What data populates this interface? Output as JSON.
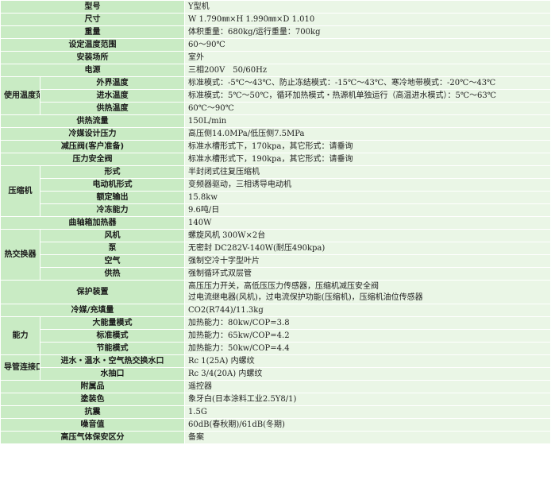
{
  "rows": {
    "model": {
      "label": "型号",
      "value": "Y型机"
    },
    "size": {
      "label": "尺寸",
      "value": "W 1.790㎜×H 1.990㎜×D 1.010"
    },
    "weight": {
      "label": "重量",
      "value": "体积重量：680kg/运行重量：700kg"
    },
    "temp_range": {
      "label": "设定温度范围",
      "value": "60～90℃"
    },
    "location": {
      "label": "安装场所",
      "value": "室外"
    },
    "power": {
      "label": "电源",
      "value": "三相200V　50/60Hz"
    },
    "use_temp": {
      "group": "使用温度范围",
      "outdoor": {
        "label": "外界温度",
        "value": "标准模式：-5℃～43℃、防止冻结模式：-15℃～43℃、寒冷地带模式：-20℃～43℃"
      },
      "inlet": {
        "label": "进水温度",
        "value": "标准模式：5℃～50℃，循环加热模式・热源机单独运行（高温进水模式）：5℃～63℃"
      },
      "supply": {
        "label": "供热温度",
        "value": "60℃～90℃"
      }
    },
    "flow": {
      "label": "供热流量",
      "value": "150L/min"
    },
    "refrig_pressure": {
      "label": "冷媒设计压力",
      "value": "高压侧14.0MPa/低压侧7.5MPa"
    },
    "relief_valve": {
      "label": "减压阀(客户准备)",
      "value": "标准水槽形式下，170kpa，其它形式：请垂询"
    },
    "safety_valve": {
      "label": "压力安全阀",
      "value": "标准水槽形式下，190kpa，其它形式：请垂询"
    },
    "compressor": {
      "group": "压缩机",
      "type": {
        "label": "形式",
        "value": "半封闭式往复压缩机"
      },
      "motor": {
        "label": "电动机形式",
        "value": "变频器驱动，三相诱导电动机"
      },
      "rated": {
        "label": "额定输出",
        "value": "15.8kw"
      },
      "cooling": {
        "label": "冷冻能力",
        "value": "9.6吨/日"
      }
    },
    "crank_heater": {
      "label": "曲轴箱加热器",
      "value": "140W"
    },
    "fan": {
      "label": "风机",
      "value": "螺旋风机 300W×2台"
    },
    "pump": {
      "label": "泵",
      "value": "无密封 DC282V-140W(耐压490kpa)"
    },
    "heat_exchanger": {
      "group": "热交换器",
      "air": {
        "label": "空气",
        "value": "强制空冷十字型叶片"
      },
      "heating": {
        "label": "供热",
        "value": "强制循环式双层管"
      }
    },
    "protection": {
      "label": "保护装置",
      "line1": "高压压力开关，高低压压力传感器，压缩机减压安全阀",
      "line2": "过电流继电器(风机)，过电流保护功能(压缩机)，压缩机油位传感器"
    },
    "refrigerant": {
      "label": "冷媒/充填量",
      "value": "CO2(R744)/11.3kg"
    },
    "capacity": {
      "group": "能力",
      "high": {
        "label": "大能量模式",
        "value": "加热能力：80kw/COP=3.8"
      },
      "standard": {
        "label": "标准模式",
        "value": "加热能力：65kw/COP=4.2"
      },
      "eco": {
        "label": "节能模式",
        "value": "加热能力：50kw/COP=4.4"
      }
    },
    "pipe": {
      "group": "导管连接口",
      "inlet": {
        "label": "进水・温水・空气热交换水口",
        "value": "Rc 1(25A) 内螺纹"
      },
      "drain": {
        "label": "水抽口",
        "value": "Rc 3/4(20A) 内螺纹"
      }
    },
    "accessory": {
      "label": "附属品",
      "value": "遥控器"
    },
    "paint": {
      "label": "塗装色",
      "value": "象牙白(日本涂料工业2.5Y8/1)"
    },
    "seismic": {
      "label": "抗震",
      "value": "1.5G"
    },
    "noise": {
      "label": "噪音值",
      "value": "60dB(春秋期)/61dB(冬期)"
    },
    "gas_law": {
      "label": "高压气体保安区分",
      "value": "备案"
    }
  }
}
